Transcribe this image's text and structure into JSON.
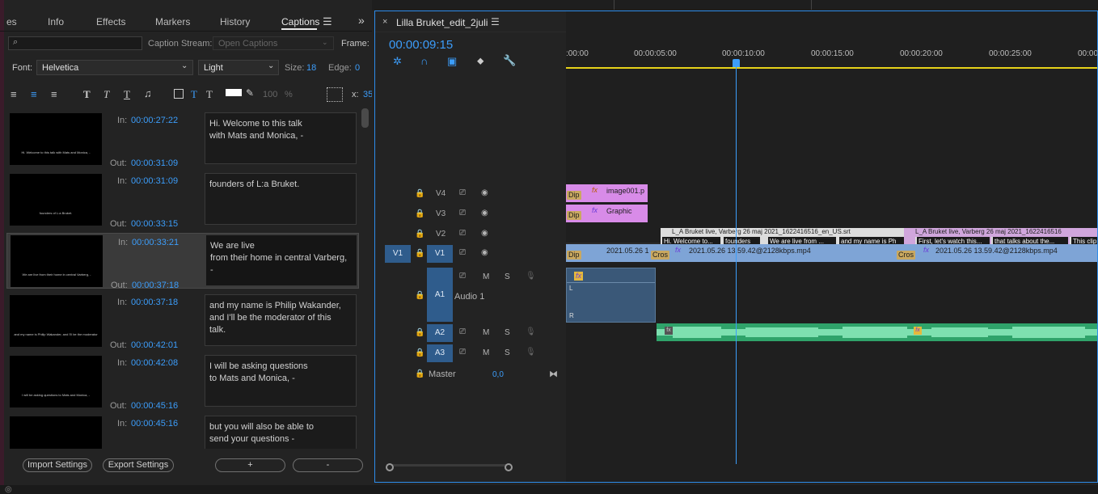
{
  "left_panel": {
    "tabs": [
      "es",
      "Info",
      "Effects",
      "Markers",
      "History",
      "Captions"
    ],
    "search_placeholder": "",
    "caption_stream_label": "Caption Stream:",
    "caption_stream_value": "Open Captions",
    "frame_label": "Frame:",
    "font_label": "Font:",
    "font_value": "Helvetica",
    "style_value": "Light",
    "size_label": "Size:",
    "size_value": "18",
    "edge_label": "Edge:",
    "edge_value": "0",
    "opacity_value": "100",
    "percent": "%",
    "x_label": "x:",
    "x_value": "35",
    "captions": [
      {
        "in": "00:00:27:22",
        "out": "00:00:31:09",
        "text": "Hi. Welcome to this talk\nwith Mats and Monica, -",
        "thumb": "Hi. Welcome to this talk\nwith Mats and Monica, -"
      },
      {
        "in": "00:00:31:09",
        "out": "00:00:33:15",
        "text": "founders of L:a Bruket.",
        "thumb": "founders of L:a Bruket."
      },
      {
        "in": "00:00:33:21",
        "out": "00:00:37:18",
        "text": "We are live\nfrom their home in central Varberg,\n-",
        "thumb": "We are live\nfrom their home in central Varberg, -"
      },
      {
        "in": "00:00:37:18",
        "out": "00:00:42:01",
        "text": "and my name is Philip Wakander,\nand I'll be the moderator of this\ntalk.",
        "thumb": "and my name is Philip Wakander,\nand I'll be the moderator"
      },
      {
        "in": "00:00:42:08",
        "out": "00:00:45:16",
        "text": "I will be asking questions\nto Mats and Monica, -",
        "thumb": "I will be asking questions\nto Mats and Monica, -"
      },
      {
        "in": "00:00:45:16",
        "out": "",
        "text": "but you will also be able to\nsend your questions -",
        "thumb": ""
      }
    ],
    "in_label": "In:",
    "out_label": "Out:",
    "import_label": "Import Settings",
    "export_label": "Export Settings",
    "add_label": "+",
    "remove_label": "-"
  },
  "sequence": {
    "title": "Lilla Bruket_edit_2juli",
    "timecode": "00:00:09:15",
    "ruler": [
      ":00:00",
      "00:00:05:00",
      "00:00:10:00",
      "00:00:15:00",
      "00:00:20:00",
      "00:00:25:00",
      "00:00"
    ],
    "tracks": {
      "v4": "V4",
      "v3": "V3",
      "v2": "V2",
      "v1": "V1",
      "v1_src": "V1",
      "a1": "A1",
      "a1_name": "Audio 1",
      "a2": "A2",
      "a3": "A3",
      "master": "Master",
      "master_value": "0,0",
      "m": "M",
      "s": "S"
    },
    "clips": {
      "image": "image001.p",
      "graphic": "Graphic",
      "dip": "Dip",
      "cross": "Cros",
      "v1_a": "2021.05.26 1",
      "v1_b": "2021.05.26 13.59.42@2128kbps.mp4",
      "v1_c": "2021.05.26 13.59.42@2128kbps.mp4",
      "srt_a": "L_A Bruket live, Varberg 26 maj 2021_1622416516_en_US.srt",
      "srt_b": "L_A Bruket live, Varberg 26 maj 2021_1622416516",
      "segs_a": [
        "Hi. Welcome to...",
        "founders",
        "We are live from ...",
        "and my name is Ph"
      ],
      "segs_b": [
        "First, let's watch this...",
        "that talks about the...",
        "This clip"
      ],
      "fx": "fx",
      "l": "L",
      "r": "R"
    }
  },
  "colors": {
    "accent": "#3c9dfa",
    "playhead": "#3c9dfa",
    "video_clip": "#7ea4d6",
    "graphic_clip": "#d88be8",
    "audio_clip": "#2fa36a"
  }
}
